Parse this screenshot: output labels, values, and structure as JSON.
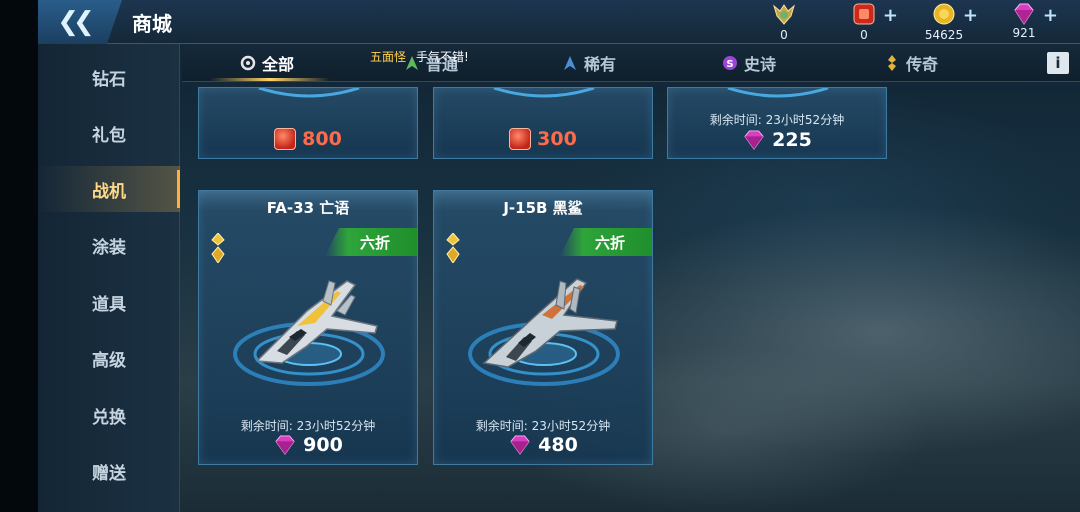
{
  "header": {
    "title": "商城",
    "back_icon": "double-chevron-left-icon"
  },
  "currencies": [
    {
      "name": "rank-medal",
      "icon": "medal-icon",
      "value": "0",
      "has_plus": false
    },
    {
      "name": "red-coupon",
      "icon": "red-coupon-icon",
      "value": "0",
      "has_plus": true,
      "plus": "+"
    },
    {
      "name": "gold-coin",
      "icon": "gold-coin-icon",
      "value": "54625",
      "has_plus": true,
      "plus": "+"
    },
    {
      "name": "diamond",
      "icon": "diamond-icon",
      "value": "921",
      "has_plus": true,
      "plus": "+"
    }
  ],
  "tabs": [
    {
      "label": "全部",
      "icon": "ring-icon",
      "active": true
    },
    {
      "label": "普通",
      "icon": "green-rarity-icon",
      "active": false
    },
    {
      "label": "稀有",
      "icon": "blue-rarity-icon",
      "active": false
    },
    {
      "label": "史诗",
      "icon": "purple-epic-icon",
      "active": false
    },
    {
      "label": "传奇",
      "icon": "gold-legend-icon",
      "active": false
    }
  ],
  "toast": {
    "who": "五面怪",
    "message": "手气不错!"
  },
  "info_label": "i",
  "sidebar": {
    "items": [
      {
        "label": "钻石",
        "active": false
      },
      {
        "label": "礼包",
        "active": false
      },
      {
        "label": "战机",
        "active": true
      },
      {
        "label": "涂装",
        "active": false
      },
      {
        "label": "道具",
        "active": false
      },
      {
        "label": "高级",
        "active": false
      },
      {
        "label": "兑换",
        "active": false
      },
      {
        "label": "赠送",
        "active": false
      }
    ]
  },
  "top_row_cards": [
    {
      "currency": "red-coupon",
      "price": "800",
      "timer": ""
    },
    {
      "currency": "red-coupon",
      "price": "300",
      "timer": ""
    },
    {
      "currency": "diamond",
      "price": "225",
      "timer": "剩余时间: 23小时52分钟"
    }
  ],
  "cards": [
    {
      "name": "FA-33 亡语",
      "discount": "六折",
      "rarity": "legendary",
      "timer": "剩余时间: 23小时52分钟",
      "currency": "diamond",
      "price": "900"
    },
    {
      "name": "J-15B 黑鲨",
      "discount": "六折",
      "rarity": "legendary",
      "timer": "剩余时间: 23小时52分钟",
      "currency": "diamond",
      "price": "480"
    }
  ],
  "colors": {
    "accent_gold": "#ffd36a",
    "discount_green": "#2fa43b",
    "coupon_red": "#ff6b4a",
    "diamond_pink": "#e23cc6"
  }
}
